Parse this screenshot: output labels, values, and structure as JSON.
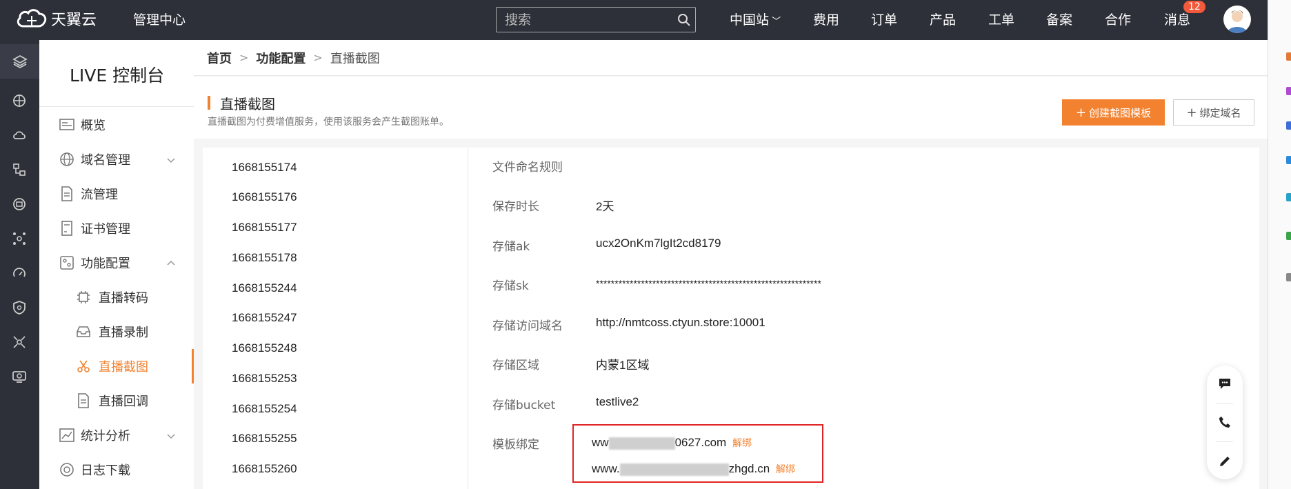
{
  "topbar": {
    "logo_text": "天翼云",
    "mgmt_center": "管理中心",
    "search_placeholder": "搜索",
    "nav": [
      "中国站",
      "费用",
      "订单",
      "产品",
      "工单",
      "备案",
      "合作",
      "消息"
    ],
    "message_badge": "12"
  },
  "sidebar": {
    "title": "LIVE 控制台",
    "items": [
      {
        "label": "概览",
        "icon": "overview-icon"
      },
      {
        "label": "域名管理",
        "icon": "globe-icon",
        "expandable": true
      },
      {
        "label": "流管理",
        "icon": "document-icon"
      },
      {
        "label": "证书管理",
        "icon": "certificate-icon"
      },
      {
        "label": "功能配置",
        "icon": "config-icon",
        "expanded": true
      },
      {
        "label": "直播转码",
        "icon": "chip-icon",
        "sub": true
      },
      {
        "label": "直播录制",
        "icon": "inbox-icon",
        "sub": true
      },
      {
        "label": "直播截图",
        "icon": "scissors-icon",
        "sub": true,
        "active": true
      },
      {
        "label": "直播回调",
        "icon": "document-icon",
        "sub": true
      },
      {
        "label": "统计分析",
        "icon": "chart-icon",
        "expandable": true
      },
      {
        "label": "日志下载",
        "icon": "download-icon"
      }
    ]
  },
  "breadcrumb": [
    "首页",
    "功能配置",
    "直播截图"
  ],
  "header": {
    "title": "直播截图",
    "description": "直播截图为付费增值服务，使用该服务会产生截图账单。",
    "create_button": "创建截图模板",
    "bind_button": "绑定域名"
  },
  "template_ids": [
    "1668155174",
    "1668155176",
    "1668155177",
    "1668155178",
    "1668155244",
    "1668155247",
    "1668155248",
    "1668155253",
    "1668155254",
    "1668155255",
    "1668155260"
  ],
  "details": [
    {
      "label": "文件命名规则",
      "value": ""
    },
    {
      "label": "保存时长",
      "value": "2天"
    },
    {
      "label": "存储ak",
      "value": "ucx2OnKm7lgIt2cd8179"
    },
    {
      "label": "存储sk",
      "value": "************************************************************"
    },
    {
      "label": "存储访问域名",
      "value": "http://nmtcoss.ctyun.store:10001"
    },
    {
      "label": "存储区域",
      "value": "内蒙1区域"
    },
    {
      "label": "存储bucket",
      "value": "testlive2"
    }
  ],
  "binding": {
    "label": "模板绑定",
    "domains": [
      {
        "prefix": "ww",
        "suffix": "0627.com",
        "action": "解绑"
      },
      {
        "prefix": "www.",
        "suffix": "zhgd.cn",
        "action": "解绑"
      }
    ]
  },
  "colors": {
    "accent": "#f28230",
    "topbar": "#2e3039",
    "highlight_box": "#e02424"
  }
}
